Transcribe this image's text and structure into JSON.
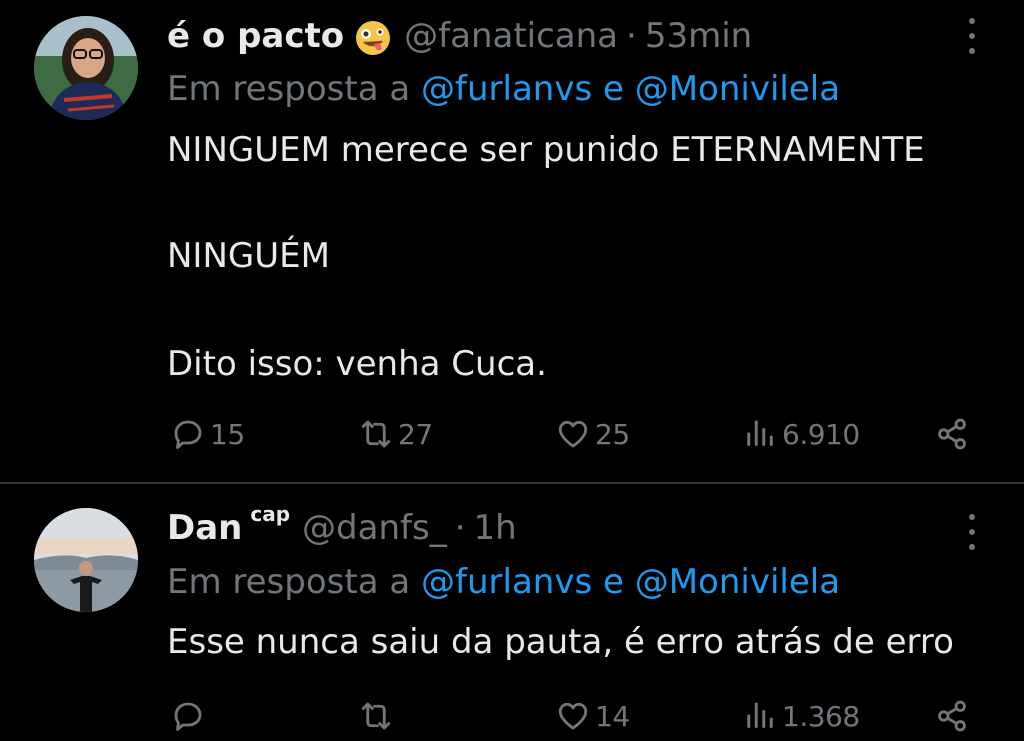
{
  "tweets": [
    {
      "display_name": "é o pacto",
      "badge_icon": "zany-face-emoji-icon",
      "handle": "@fanaticana",
      "separator": "·",
      "time": "53min",
      "reply_prefix": "Em resposta a",
      "reply_mention_1": "@furlanvs",
      "reply_joiner": "e",
      "reply_mention_2": "@Monivilela",
      "body_lines": [
        "NINGUEM merece ser punido ETERNAMENTE",
        "NINGUÉM",
        "Dito isso: venha Cuca."
      ],
      "replies": "15",
      "retweets": "27",
      "likes": "25",
      "views": "6.910"
    },
    {
      "display_name": "Dan",
      "name_suffix": "cap",
      "handle": "@danfs_",
      "separator": "·",
      "time": "1h",
      "reply_prefix": "Em resposta a",
      "reply_mention_1": "@furlanvs",
      "reply_joiner": "e",
      "reply_mention_2": "@Monivilela",
      "body_lines": [
        "Esse nunca saiu da pauta, é erro atrás de erro"
      ],
      "replies": "",
      "retweets": "",
      "likes": "14",
      "views": "1.368"
    }
  ],
  "icons": {
    "reply": "reply-icon",
    "retweet": "retweet-icon",
    "like": "heart-icon",
    "views": "views-icon",
    "share": "share-icon",
    "more": "more-options-icon"
  },
  "colors": {
    "background": "#000000",
    "text": "#e7e9ea",
    "secondary": "#71767b",
    "mention": "#1d9bf0",
    "divider": "#2f3336"
  }
}
